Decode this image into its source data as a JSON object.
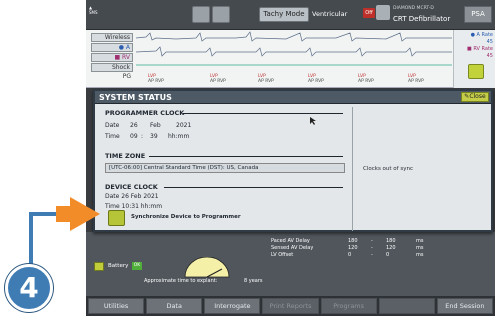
{
  "topbar": {
    "top_left_small": "1\nSMS",
    "tachy_mode": "Tachy Mode",
    "ventricular_label": "Ventricular",
    "off_badge": "Off",
    "device_name": "DIAMOND MCRT-D",
    "device_type": "CRT Defibrillator",
    "psa_label": "PSA"
  },
  "ecg": {
    "buttons": [
      "Wireless",
      "● A",
      "■ RV",
      "Shock"
    ],
    "pg_label": "PG",
    "rate_a_label": "● A Rate",
    "rate_a_value": "45",
    "rate_rv_label": "■ RV Rate",
    "rate_rv_value": "45",
    "markers": [
      {
        "top": "LVP",
        "bottom": "AP RVP"
      },
      {
        "top": "LVP",
        "bottom": "AP RVP"
      },
      {
        "top": "LVP",
        "bottom": "AP RVP"
      },
      {
        "top": "LVP",
        "bottom": "AP RVP"
      },
      {
        "top": "LVP",
        "bottom": "AP RVP"
      },
      {
        "top": "LVP",
        "bottom": "AP RVP"
      }
    ],
    "colors": {
      "a": "#2d5fb0",
      "rv": "#a03070",
      "trace": "#3a6aa0"
    }
  },
  "dialog": {
    "title": "SYSTEM STATUS",
    "close_label": "Close",
    "programmer_clock": {
      "heading": "PROGRAMMER CLOCK",
      "date_label": "Date",
      "day": "26",
      "month": "Feb",
      "year": "2021",
      "time_label": "Time",
      "hour": "09",
      "colon": ":",
      "minute": "39",
      "unit": "hh:mm"
    },
    "time_zone": {
      "heading": "TIME ZONE",
      "value": "[UTC-06:00] Central Standard Time (DST): US, Canada"
    },
    "device_clock": {
      "heading": "DEVICE CLOCK",
      "date_line": "Date  26 Feb 2021",
      "time_line": "Time  10:31 hh:mm"
    },
    "sync_label": "Synchronize Device to Programmer",
    "status_message": "Clocks out of sync"
  },
  "lower": {
    "battery_label": "Battery",
    "battery_badge": "OK",
    "explant_label": "Approximate time to explant:",
    "explant_value": "8 years",
    "params": [
      {
        "name": "Paced AV Delay",
        "v1": "180",
        "v2": "180",
        "unit": "ms"
      },
      {
        "name": "Sensed AV Delay",
        "v1": "120",
        "v2": "120",
        "unit": "ms"
      },
      {
        "name": "LV Offset",
        "v1": "0",
        "v2": "0",
        "unit": "ms"
      }
    ],
    "dash": "-"
  },
  "nav": {
    "items": [
      "Utilities",
      "Data",
      "Interrogate",
      "Print Reports",
      "Programs",
      "",
      "End Session"
    ],
    "dim": [
      false,
      false,
      false,
      true,
      true,
      true,
      false
    ]
  },
  "callout": {
    "number": "4",
    "color": "#3f7cb4"
  }
}
